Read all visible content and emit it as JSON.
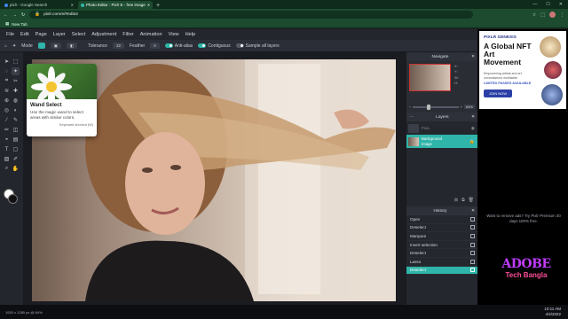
{
  "browser": {
    "tabs": [
      {
        "label": "pixlr - Google Search",
        "active": false
      },
      {
        "label": "Photo Editor : Pixlr E - free image",
        "active": true
      }
    ],
    "url": "pixlr.com/e/#editor",
    "bookmark_label": "New Tab"
  },
  "menu": {
    "items": [
      "File",
      "Edit",
      "Page",
      "Layer",
      "Select",
      "Adjustment",
      "Filter",
      "Animation",
      "View",
      "Help"
    ]
  },
  "options": {
    "mode_label": "Mode",
    "tolerance_label": "Tolerance",
    "tolerance_value": "32",
    "feather_label": "Feather",
    "feather_value": "0",
    "antialias_label": "Anti-alias",
    "contiguous_label": "Contiguous",
    "sample_label": "Sample all layers"
  },
  "tooltip": {
    "title": "Wand Select",
    "description": "Use the magic wand to select areas with similar colors.",
    "shortcut": "Keyboard shortcut (W)"
  },
  "navigate": {
    "title": "Navigate",
    "x_label": "X:",
    "y_label": "Y:",
    "w_label": "W:",
    "h_label": "H:",
    "zoom": "64%"
  },
  "layers": {
    "title": "Layers",
    "items": [
      {
        "name": "Fixe..",
        "sub": "",
        "selected": false
      },
      {
        "name": "Background",
        "sub": "Image",
        "selected": true
      }
    ]
  },
  "history": {
    "title": "History",
    "items": [
      {
        "label": "Open",
        "selected": false
      },
      {
        "label": "Deselect",
        "selected": false
      },
      {
        "label": "Marquee",
        "selected": false
      },
      {
        "label": "Invert selection",
        "selected": false
      },
      {
        "label": "Deselect",
        "selected": false
      },
      {
        "label": "Lasso",
        "selected": false
      },
      {
        "label": "Deselect",
        "selected": true
      }
    ]
  },
  "ad": {
    "brand": "PIXLR GENESIS",
    "headline": "A Global NFT Art Movement",
    "sub": "Empowering artists and art connoisseurs worldwide",
    "limited": "LIMITED PASSES AVAILABLE",
    "cta": "JOIN NOW",
    "note": "Want to remove ads? Try Pixlr Premium 30 days 100% free."
  },
  "status": {
    "dimensions": "1920 x 1280 px @ 64%",
    "time": "10:11 AM",
    "date": "4/4/2022"
  },
  "watermark": {
    "line1": "ADOBE",
    "line2": "Tech Bangla"
  },
  "colors": {
    "accent": "#2fb5a9",
    "chrome_green": "#1c4b2f"
  }
}
